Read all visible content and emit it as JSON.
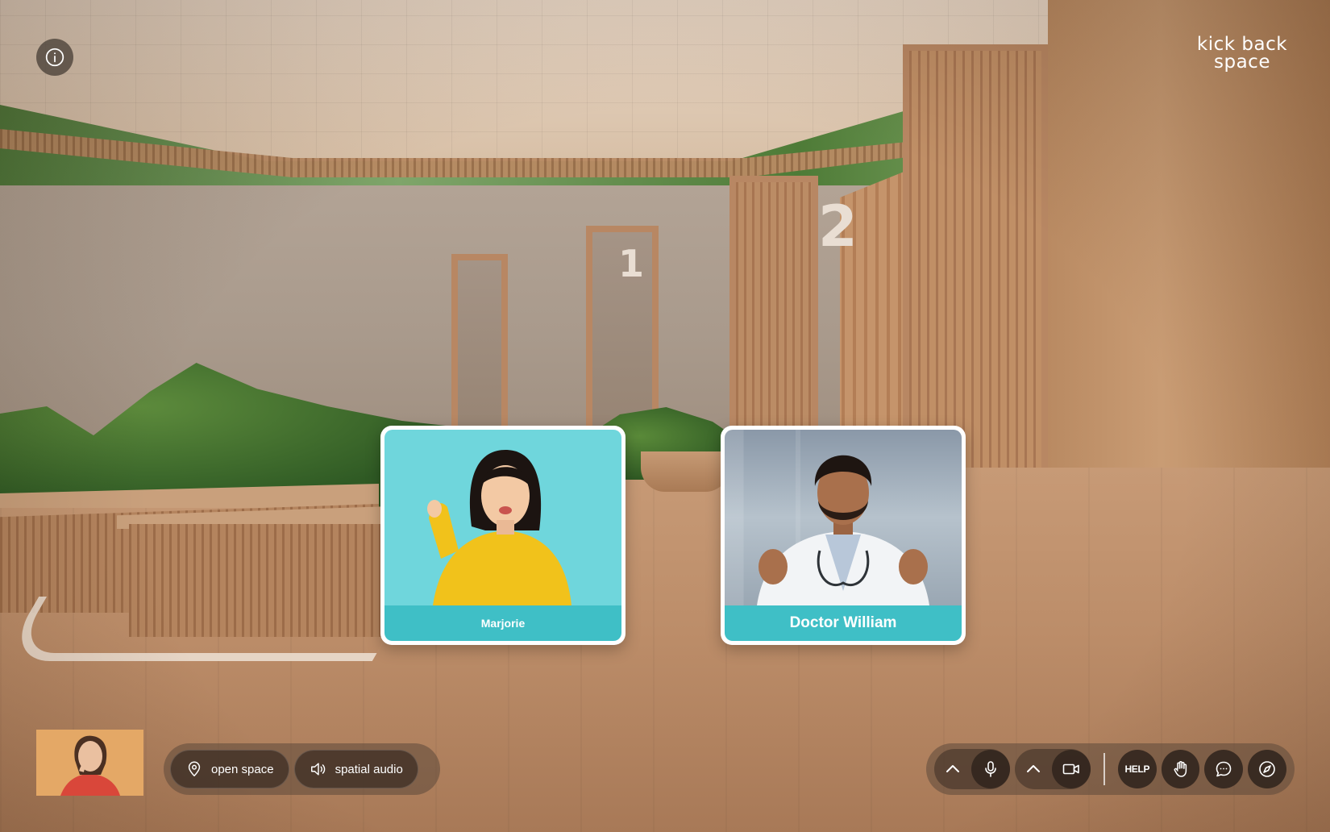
{
  "brand": {
    "line1": "kick back",
    "line2": "space"
  },
  "scene": {
    "door_numbers": [
      "1",
      "2"
    ]
  },
  "participants": [
    {
      "name": "Marjorie",
      "accent": "#3fbfc6",
      "background": "#6fd6dc"
    },
    {
      "name": "Doctor William",
      "accent": "#3fbfc6"
    }
  ],
  "left_toolbar": {
    "location_label": "open space",
    "location_icon": "map-pin-icon",
    "audio_label": "spatial audio",
    "audio_icon": "speaker-icon"
  },
  "right_toolbar": {
    "help_label": "HELP",
    "icons": [
      "chevron-up-icon",
      "microphone-icon",
      "chevron-up-icon",
      "camera-icon",
      "help-icon",
      "raise-hand-icon",
      "chat-icon",
      "compass-icon"
    ]
  },
  "colors": {
    "name_bar": "#3fbfc6",
    "toolbar": "#5c483a"
  }
}
